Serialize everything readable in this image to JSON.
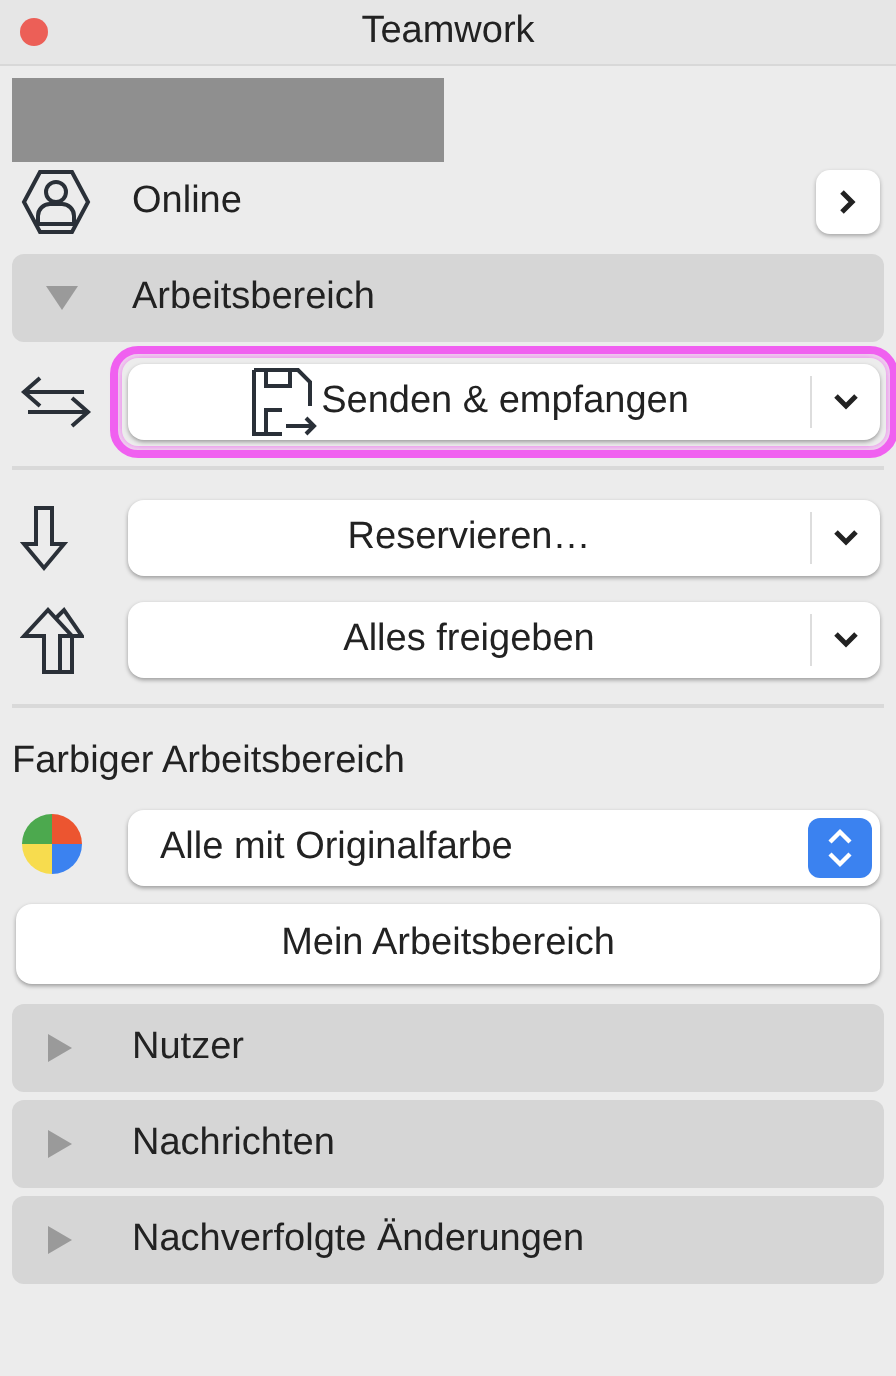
{
  "window": {
    "title": "Teamwork"
  },
  "user": {
    "redacted": true,
    "status": "Online"
  },
  "workspace_section": {
    "title": "Arbeitsbereich",
    "expanded": true
  },
  "actions": [
    {
      "kind": "exchange",
      "label": "Senden & empfangen",
      "file_icon": true,
      "highlighted": true
    },
    {
      "kind": "down",
      "label": "Reservieren…",
      "file_icon": false,
      "highlighted": false
    },
    {
      "kind": "up",
      "label": "Alles freigeben",
      "file_icon": false,
      "highlighted": false
    }
  ],
  "color_workspace": {
    "heading": "Farbiger Arbeitsbereich",
    "value": "Alle mit Originalfarbe"
  },
  "my_workspace_button": "Mein Arbeitsbereich",
  "sections": [
    {
      "title": "Nutzer",
      "expanded": false
    },
    {
      "title": "Nachrichten",
      "expanded": false
    },
    {
      "title": "Nachverfolgte Änderungen",
      "expanded": false
    }
  ]
}
